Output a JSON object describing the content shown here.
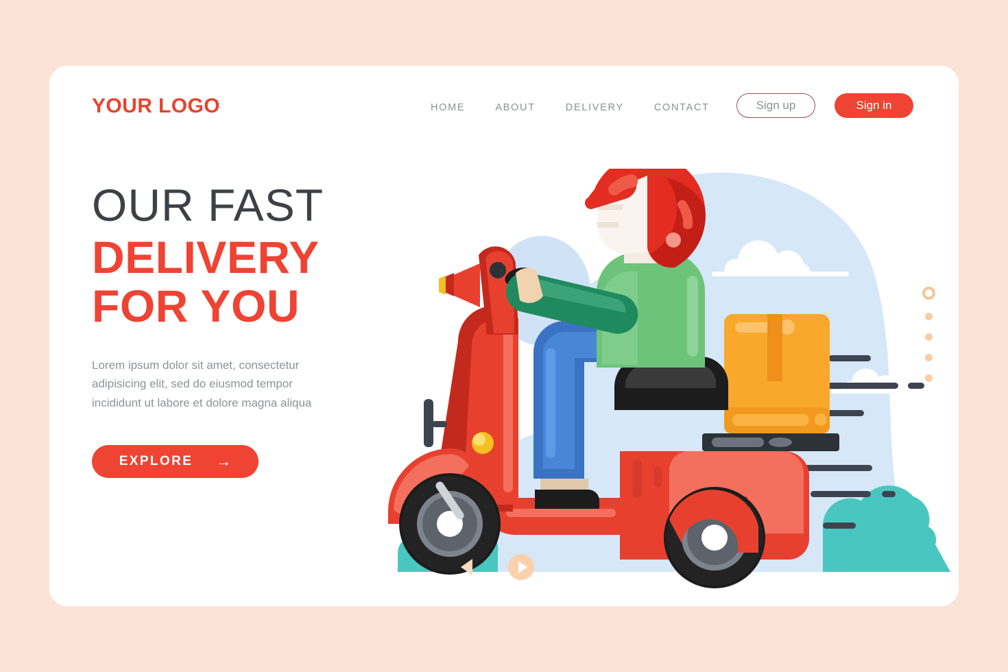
{
  "brand": {
    "logo": "YOUR LOGO",
    "accent": "#ef4333",
    "page_bg": "#fce3d7",
    "card_bg": "#ffffff"
  },
  "nav": {
    "items": [
      {
        "label": "HOME"
      },
      {
        "label": "ABOUT"
      },
      {
        "label": "DELIVERY"
      },
      {
        "label": "CONTACT"
      }
    ],
    "sign_up": "Sign up",
    "sign_in": "Sign in"
  },
  "hero": {
    "headline_line1": "OUR FAST",
    "headline_line2": "DELIVERY",
    "headline_line3": "FOR YOU",
    "paragraph": "Lorem ipsum dolor sit amet, consectetur adipisicing elit, sed do eiusmod tempor incididunt ut labore et dolore magna aliqua",
    "cta_label": "EXPLORE",
    "cta_icon": "arrow-right-icon",
    "cta_arrow": "→"
  },
  "illustration": {
    "name": "delivery-scooter-illustration",
    "alt": "Delivery rider on a red scooter carrying an orange parcel box",
    "colors": {
      "blob": "#d6e7f8",
      "sun": "#cfe2f6",
      "cloud": "#ffffff",
      "bush": "#49c6c0",
      "helmet": "#e22d20",
      "helmet_dark": "#c41f16",
      "face": "#fbf4ee",
      "jacket": "#6ec37a",
      "jacket_sleeve": "#1f8a5e",
      "pants": "#3a72c4",
      "scooter": "#e8402f",
      "scooter_dark": "#c32a1d",
      "scooter_light": "#f4705e",
      "box": "#f9a82c",
      "box_dark": "#ef8f1c",
      "tire": "#1c1c1c",
      "speed_line": "#3d444f",
      "headlight": "#f6c020"
    }
  },
  "carousel": {
    "prev_icon": "triangle-left-icon",
    "next_icon": "play-circle-icon",
    "dots": [
      {
        "active": true
      },
      {
        "active": false
      },
      {
        "active": false
      },
      {
        "active": false
      },
      {
        "active": false
      }
    ]
  }
}
